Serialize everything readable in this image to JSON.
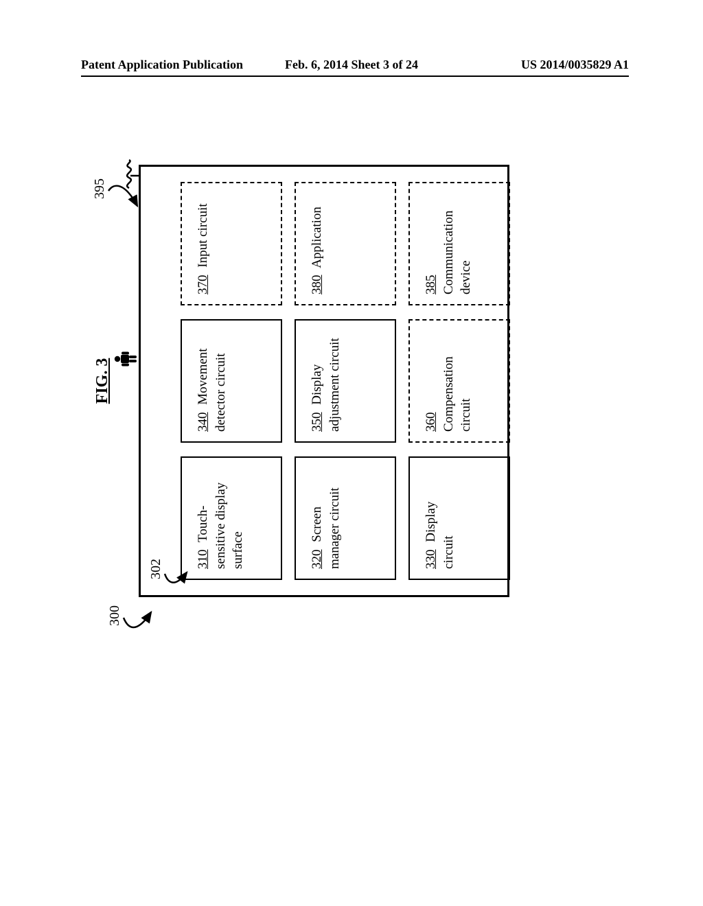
{
  "header": {
    "left": "Patent Application Publication",
    "center": "Feb. 6, 2014   Sheet 3 of 24",
    "right": "US 2014/0035829 A1"
  },
  "figure": {
    "title": "FIG. 3",
    "ref300": "300",
    "ref302": "302",
    "ref395": "395"
  },
  "blocks": {
    "b310": {
      "ref": "310",
      "text": "Touch-sensitive display surface"
    },
    "b320": {
      "ref": "320",
      "text": "Screen manager circuit"
    },
    "b330": {
      "ref": "330",
      "text": "Display circuit"
    },
    "b340": {
      "ref": "340",
      "text": "Movement detector circuit"
    },
    "b350": {
      "ref": "350",
      "text": "Display adjustment circuit"
    },
    "b360": {
      "ref": "360",
      "text": "Compensation circuit"
    },
    "b370": {
      "ref": "370",
      "text": "Input circuit"
    },
    "b380": {
      "ref": "380",
      "text": "Application"
    },
    "b385": {
      "ref": "385",
      "text": "Communication device"
    }
  }
}
